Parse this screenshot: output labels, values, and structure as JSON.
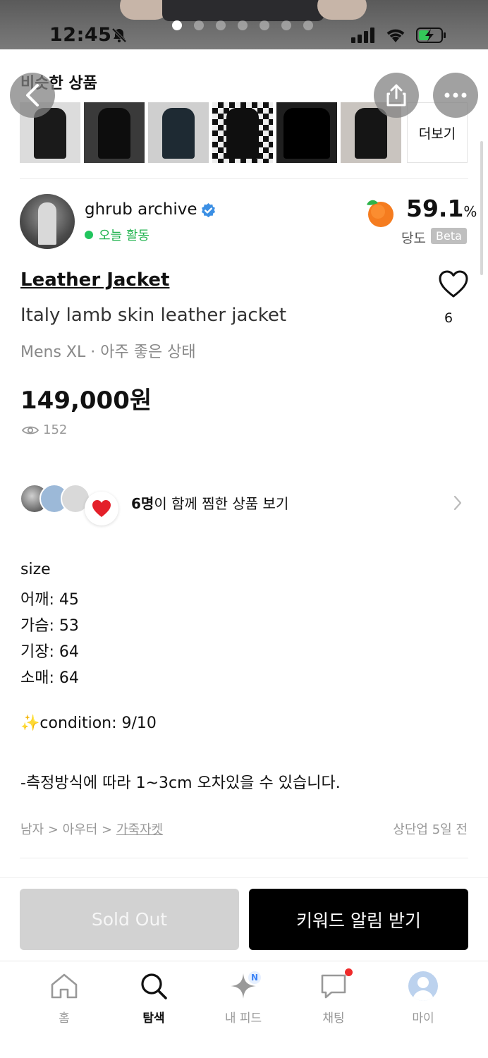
{
  "status_bar": {
    "time": "12:45",
    "carousel_count": 7,
    "carousel_active": 0
  },
  "similar": {
    "title": "비슷한 상품",
    "more_label": "더보기",
    "thumbnails": [
      "similar-item-1",
      "similar-item-2",
      "similar-item-3",
      "similar-item-4",
      "similar-item-5",
      "similar-item-6"
    ]
  },
  "seller": {
    "name": "ghrub archive",
    "activity": "오늘 활동",
    "rate_value": "59.1",
    "rate_unit": "%",
    "rate_label": "당도",
    "rate_badge": "Beta"
  },
  "product": {
    "brand": "Leather Jacket",
    "title": "Italy lamb skin leather jacket",
    "meta": "Mens XL · 아주 좋은 상태",
    "price": "149,000원",
    "views": "152",
    "likes": "6"
  },
  "wishlist": {
    "count_bold": "6명",
    "text": "이 함께 찜한 상품 보기"
  },
  "description": [
    "size",
    "어깨: 45",
    "가슴: 53",
    "기장: 64",
    "소매: 64",
    "✨condition: 9/10",
    "-측정방식에 따라 1~3cm 오차있을 수 있습니다."
  ],
  "category": {
    "path": "남자 > 아우터 > ",
    "leaf": "가죽자켓",
    "bumped": "상단업 5일 전"
  },
  "actions": {
    "sold_out": "Sold Out",
    "keyword_alert": "키워드 알림 받기"
  },
  "tabs": [
    {
      "label": "홈",
      "icon": "home-icon"
    },
    {
      "label": "탐색",
      "icon": "search-icon",
      "active": true
    },
    {
      "label": "내 피드",
      "icon": "sparkle-icon",
      "badge": "N"
    },
    {
      "label": "채팅",
      "icon": "chat-icon"
    },
    {
      "label": "마이",
      "icon": "profile-icon"
    }
  ],
  "colors": {
    "accent_green": "#21b34f",
    "verified_blue": "#3b8fe4",
    "notification_red": "#ef2b2b"
  }
}
